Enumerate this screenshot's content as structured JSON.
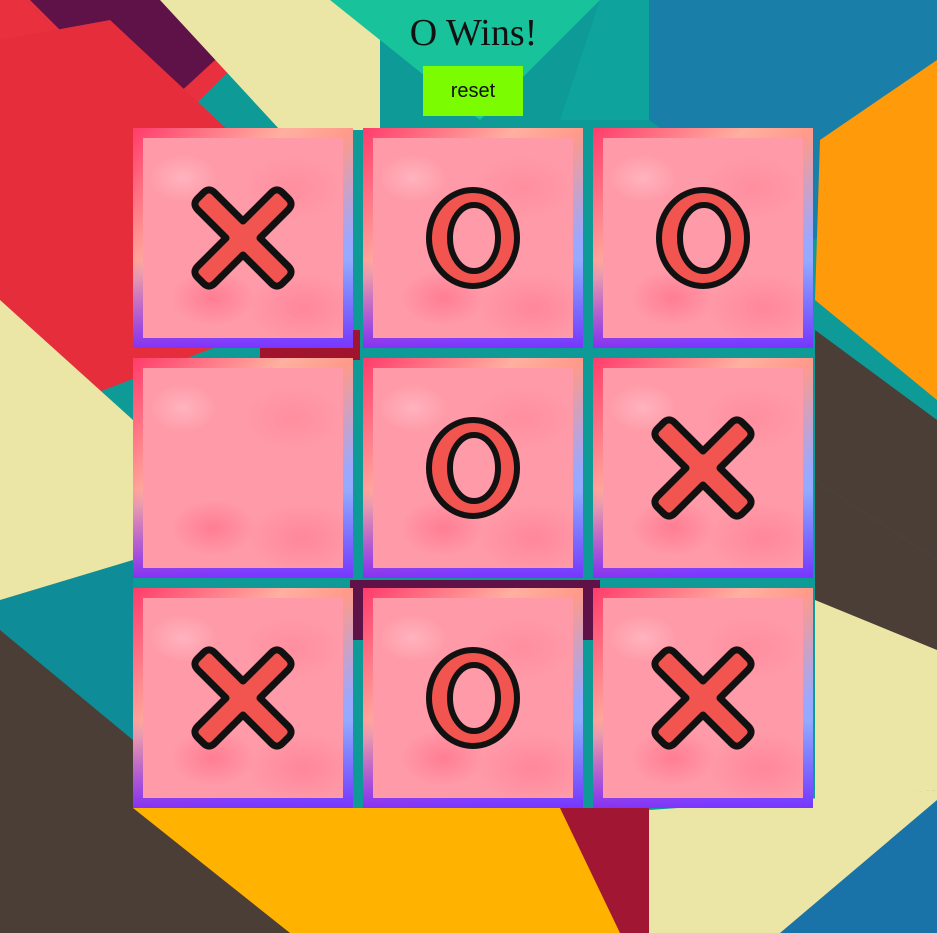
{
  "status": "O Wins!",
  "reset_label": "reset",
  "colors": {
    "reset_bg": "#7cfc00",
    "mark_fill": "#f2544f",
    "mark_stroke": "#111111",
    "tile_bg": "#ff9aa8"
  },
  "board": [
    [
      "X",
      "O",
      "O"
    ],
    [
      "",
      "O",
      "X"
    ],
    [
      "X",
      "O",
      "X"
    ]
  ]
}
